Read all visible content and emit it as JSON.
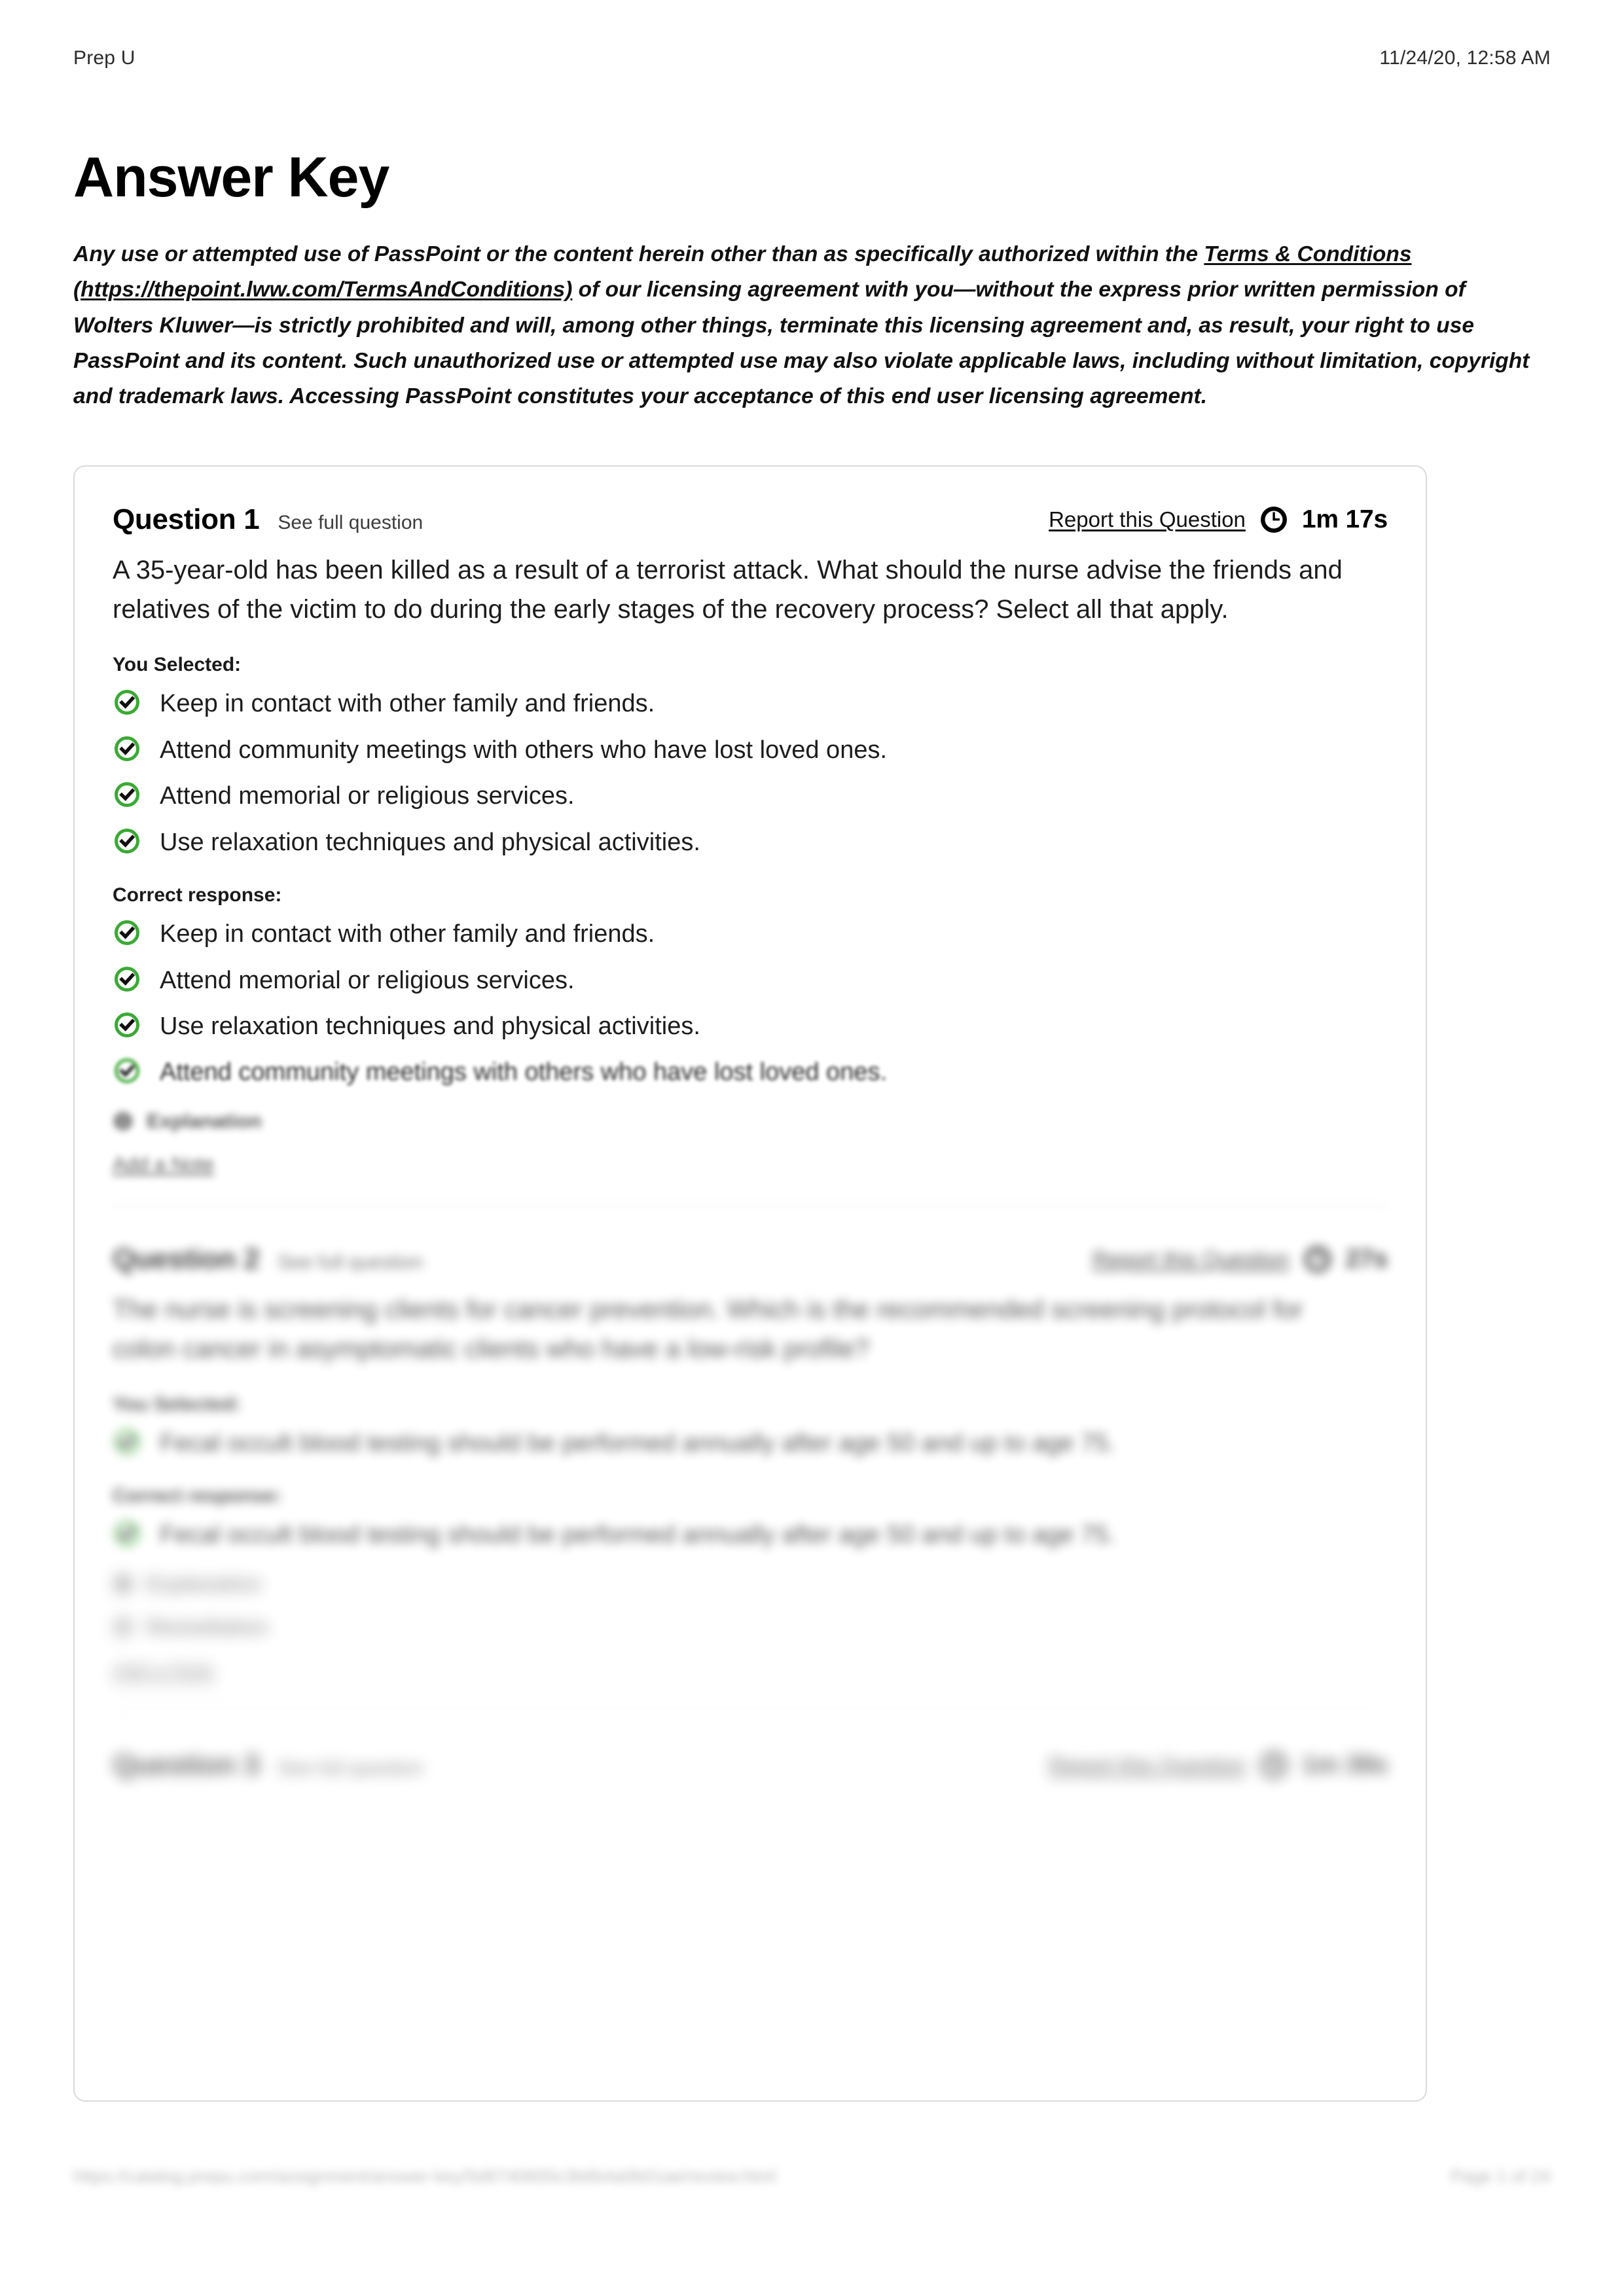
{
  "header": {
    "app_name": "Prep U",
    "timestamp": "11/24/20, 12:58 AM"
  },
  "title": "Answer Key",
  "legal": {
    "part1": "Any use or attempted use of PassPoint or the content herein other than as specifically authorized within the ",
    "link_label": "Terms & Conditions (https://thepoint.lww.com/TermsAndConditions)",
    "part2": " of our licensing agreement with you—without the express prior written permission of Wolters Kluwer—is strictly prohibited and will, among other things, terminate this licensing agreement and, as result, your right to use PassPoint and its content. Such unauthorized use or attempted use may also violate applicable laws, including without limitation, copyright and trademark laws. Accessing PassPoint constitutes your acceptance of this end user licensing agreement."
  },
  "labels": {
    "see_full_question": "See full question",
    "report_question": "Report this Question",
    "you_selected": "You Selected:",
    "correct_response": "Correct response:",
    "explanation": "Explanation",
    "remediation": "Remediation",
    "add_a_note": "Add a Note"
  },
  "colors": {
    "check_green": "#3aa935",
    "card_border": "#d9d9d9",
    "text": "#1c1c1c",
    "muted": "#8a8a8a"
  },
  "icons": {
    "clock": "clock-icon",
    "check_circle": "check-circle-icon",
    "explanation": "info-icon",
    "remediation": "book-icon"
  },
  "questions": [
    {
      "number": "Question 1",
      "time": "1m 17s",
      "text": "A 35-year-old has been killed as a result of a terrorist attack. What should the nurse advise the friends and relatives of the victim to do during the early stages of the recovery process? Select all that apply.",
      "selected": [
        "Keep in contact with other family and friends.",
        "Attend community meetings with others who have lost loved ones.",
        "Attend memorial or religious services.",
        "Use relaxation techniques and physical activities."
      ],
      "correct": [
        "Keep in contact with other family and friends.",
        "Attend memorial or religious services.",
        "Use relaxation techniques and physical activities.",
        "Attend community meetings with others who have lost loved ones."
      ]
    },
    {
      "number": "Question 2",
      "time": "27s",
      "text": "The nurse is screening clients for cancer prevention. Which is the recommended screening protocol for colon cancer in asymptomatic clients who have a low-risk profile?",
      "selected": [
        "Fecal occult blood testing should be performed annually after age 50 and up to age 75."
      ],
      "correct": [
        "Fecal occult blood testing should be performed annually after age 50 and up to age 75."
      ]
    },
    {
      "number": "Question 3",
      "time": "1m 39s",
      "text": "",
      "selected": [],
      "correct": []
    }
  ],
  "footer": {
    "url": "https://catalog.prepu.com/assignment/answer-key/5d6740600c3b6b4a0b01ae/review.html",
    "page": "Page 1 of 24"
  }
}
